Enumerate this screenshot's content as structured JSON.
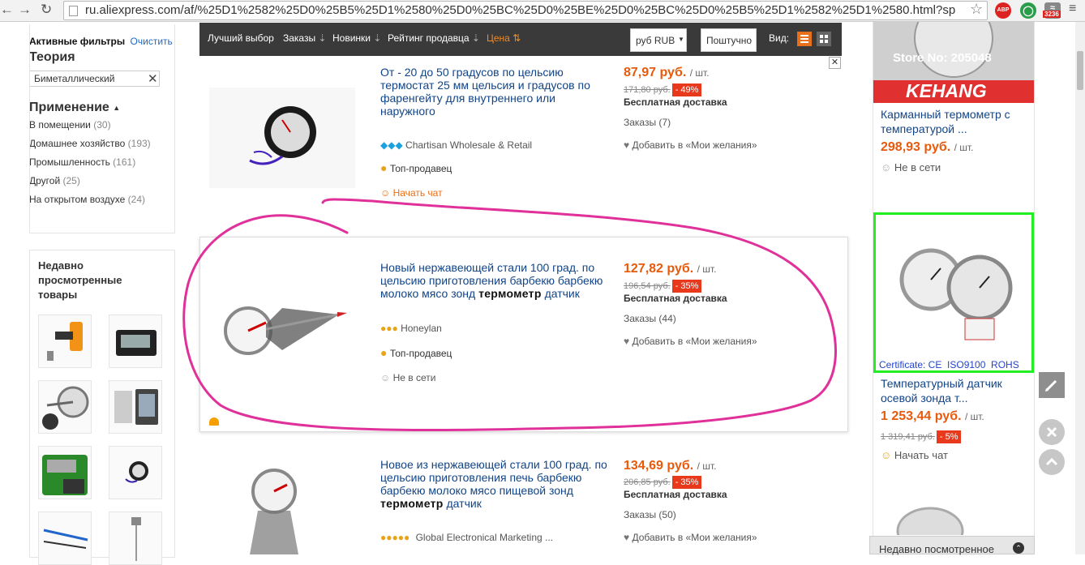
{
  "browser": {
    "url": "ru.aliexpress.com/af/%25D1%2582%25D0%25B5%25D1%2580%25D0%25BC%25D0%25BE%25D0%25BC%25D0%25B5%25D1%2582%25D1%2580.html?sp",
    "abp_label": "ABP",
    "rss_badge": "3236"
  },
  "filters": {
    "active_title": "Активные фильтры",
    "clear_label": "Очистить",
    "theory_title": "Теория",
    "theory_value": "Биметаллический",
    "application_title": "Применение",
    "items": [
      {
        "label": "В помещении",
        "count": "(30)"
      },
      {
        "label": "Домашнее хозяйство",
        "count": "(193)"
      },
      {
        "label": "Промышленность",
        "count": "(161)"
      },
      {
        "label": "Другой",
        "count": "(25)"
      },
      {
        "label": "На открытом воздухе",
        "count": "(24)"
      }
    ]
  },
  "recent": {
    "title": "Недавно просмотренные товары"
  },
  "sortbar": {
    "best": "Лучший выбор",
    "orders": "Заказы",
    "new": "Новинки",
    "rating": "Рейтинг продавца",
    "price": "Цена",
    "currency": "руб RUB",
    "per_unit": "Поштучно",
    "view_label": "Вид:"
  },
  "products": [
    {
      "title": "От - 20 до 50 градусов по цельсию термостат 25 мм цельсия и градусов по фаренгейту для внутреннего или наружного",
      "title_bold": "",
      "title_after": "",
      "price": "87,97 руб.",
      "unit": "/ шт.",
      "old_price": "171,80 руб.",
      "discount": "- 49%",
      "shipping": "Бесплатная доставка",
      "orders": "Заказы (7)",
      "wishlist": "Добавить в «Мои желания»",
      "seller": "Chartisan Wholesale & Retail",
      "top_seller": "Топ-продавец",
      "chat": "Начать чат"
    },
    {
      "title": "Новый нержавеющей стали 100 град. по цельсию приготовления барбекю барбекю молоко мясо зонд ",
      "title_bold": "термометр",
      "title_after": " датчик",
      "price": "127,82 руб.",
      "unit": "/ шт.",
      "old_price": "196,54 руб.",
      "discount": "- 35%",
      "shipping": "Бесплатная доставка",
      "orders": "Заказы (44)",
      "wishlist": "Добавить в «Мои желания»",
      "seller": "Honeylan",
      "top_seller": "Топ-продавец",
      "chat": "Не в сети"
    },
    {
      "title": "Новое из нержавеющей стали 100 град. по цельсию приготовления печь барбекю барбекю молоко мясо пищевой зонд ",
      "title_bold": "термометр",
      "title_after": " датчик",
      "price": "134,69 руб.",
      "unit": "/ шт.",
      "old_price": "206,85 руб.",
      "discount": "- 35%",
      "shipping": "Бесплатная доставка",
      "orders": "Заказы (50)",
      "wishlist": "Добавить в «Мои желания»",
      "seller": "Global Electronical Marketing ..."
    }
  ],
  "right": {
    "ad1": {
      "banner_store": "Store No: 205048",
      "banner_brand": "KEHANG",
      "title": "Карманный термометр с температурой ...",
      "price": "298,93 руб.",
      "unit": "/ шт.",
      "status": "Не в сети"
    },
    "ad2": {
      "certificate": "Certificate: CE  ISO9100  ROHS",
      "title": "Температурный датчик осевой зонда т...",
      "price": "1 253,44 руб.",
      "unit": "/ шт.",
      "old_price": "1 319,41 руб.",
      "discount": "- 5%",
      "chat": "Начать чат"
    },
    "recent_bar": "Недавно посмотренное"
  },
  "colors": {
    "price": "#e85a0c",
    "link": "#114488",
    "discount_bg": "#e8391d",
    "sortbar_bg": "#3a3a3a",
    "annotation": "#e0309a",
    "ad_border": "#22ee22"
  }
}
